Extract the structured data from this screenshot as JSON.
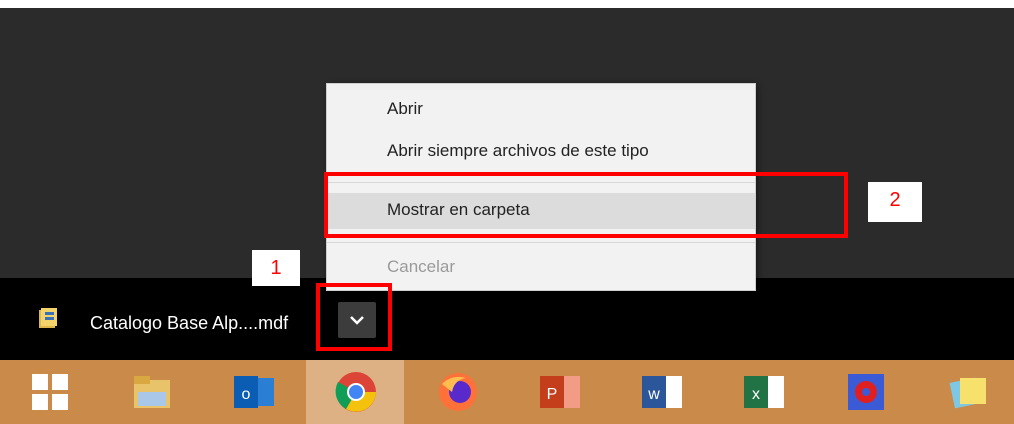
{
  "download": {
    "file_name": "Catalogo Base Alp....mdf"
  },
  "context_menu": {
    "items": [
      {
        "label": "Abrir"
      },
      {
        "label": "Abrir siempre archivos de este tipo"
      },
      {
        "label": "Mostrar en carpeta"
      },
      {
        "label": "Cancelar"
      }
    ]
  },
  "callouts": {
    "one": "1",
    "two": "2"
  },
  "taskbar": {
    "buttons": [
      {
        "icon": "windows-start-icon"
      },
      {
        "icon": "file-explorer-icon"
      },
      {
        "icon": "outlook-icon"
      },
      {
        "icon": "chrome-icon"
      },
      {
        "icon": "firefox-icon"
      },
      {
        "icon": "powerpoint-icon"
      },
      {
        "icon": "word-icon"
      },
      {
        "icon": "excel-icon"
      },
      {
        "icon": "app-gear-icon"
      },
      {
        "icon": "sticky-notes-icon"
      }
    ]
  },
  "colors": {
    "callout": "#ff0000",
    "taskbar": "#c98a4a",
    "menu_hover": "#dcdcdc"
  }
}
